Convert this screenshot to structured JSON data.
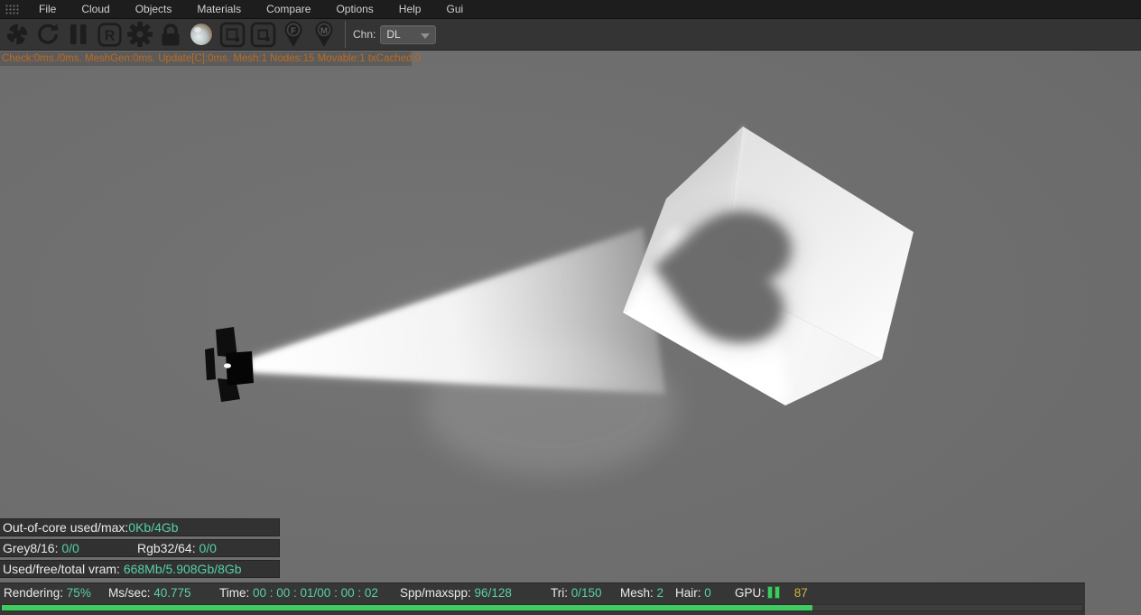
{
  "menu_bar": {
    "items": [
      "File",
      "Cloud",
      "Objects",
      "Materials",
      "Compare",
      "Options",
      "Help",
      "Gui"
    ]
  },
  "toolbar": {
    "icons": [
      "octane-logo",
      "restart-render",
      "pause-render",
      "reset-render",
      "kernel-settings",
      "lock-camera",
      "material-preview",
      "render-region",
      "pick-region",
      "focus-picker",
      "material-picker"
    ],
    "reset_letter": "R",
    "focus_letter": "F",
    "material_letter": "M",
    "channel_label": "Chn:",
    "channel_value": "DL"
  },
  "status_line": "Check:0ms./0ms. MeshGen:0ms. Update[C]:0ms. Mesh:1 Nodes:15 Movable:1 txCached:0",
  "memory_overlay": {
    "out_of_core_label": "Out-of-core used/max:",
    "out_of_core_value": "0Kb/4Gb",
    "grey_label": "Grey8/16: ",
    "grey_value": "0/0",
    "rgb_label": "Rgb32/64: ",
    "rgb_value": "0/0",
    "vram_label": "Used/free/total vram: ",
    "vram_value": "668Mb/5.908Gb/8Gb"
  },
  "status_bar": {
    "rendering_label": "Rendering: ",
    "rendering_value": "75%",
    "mssec_label": "Ms/sec: ",
    "mssec_value": "40.775",
    "time_label": "Time: ",
    "time_value": "00 : 00 : 01/00 : 00 : 02",
    "spp_label": "Spp/maxspp: ",
    "spp_value": "96/128",
    "tri_label": "Tri: ",
    "tri_value": "0/150",
    "mesh_label": "Mesh: ",
    "mesh_value": "2",
    "hair_label": "Hair: ",
    "hair_value": "0",
    "gpu_label": "GPU:",
    "gpu_value": "87",
    "progress_percent": 75
  },
  "colors": {
    "teal": "#57d1a4",
    "orange": "#bc6a20",
    "green": "#3ecb5f",
    "yellow": "#cdb243"
  }
}
